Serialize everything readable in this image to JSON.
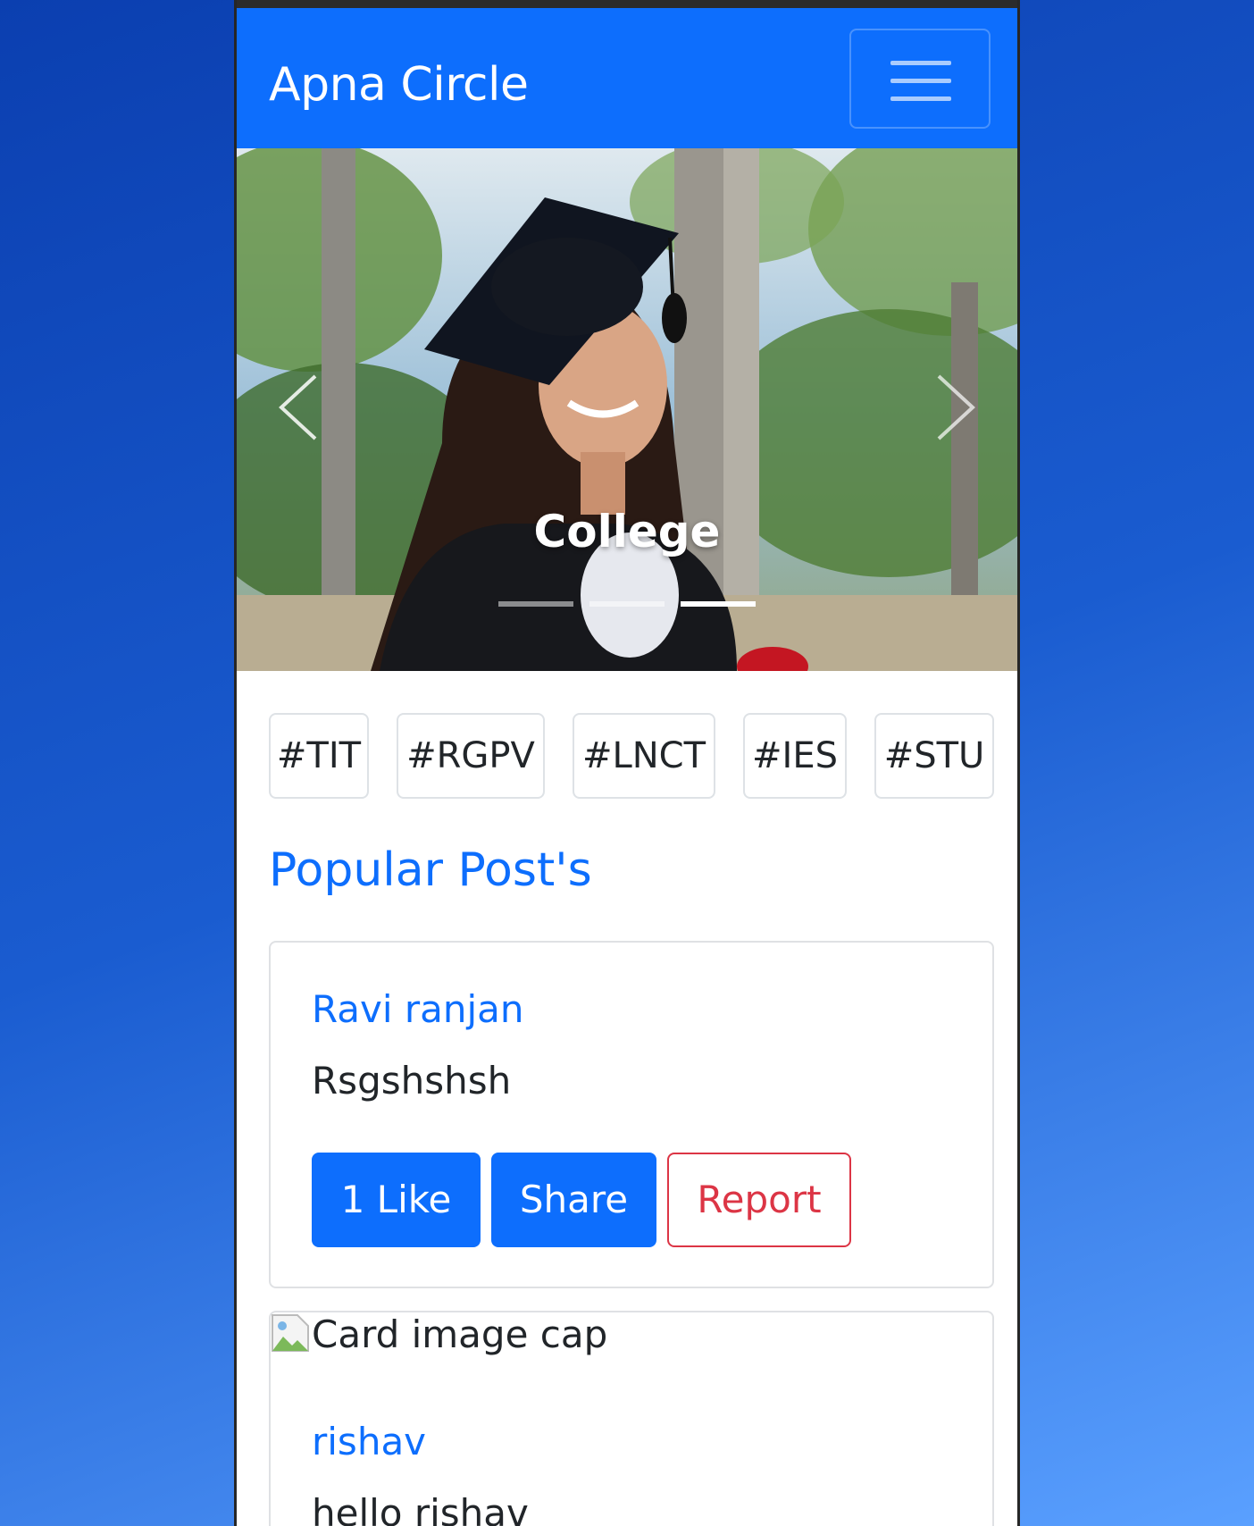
{
  "navbar": {
    "brand": "Apna Circle",
    "toggler_icon": "hamburger-menu-icon"
  },
  "carousel": {
    "caption": "College",
    "slide_count": 3,
    "active_slide": 3,
    "prev_icon": "chevron-left-icon",
    "next_icon": "chevron-right-icon"
  },
  "tags": [
    "#TIT",
    "#RGPV",
    "#LNCT",
    "#IES",
    "#STU"
  ],
  "section_title": "Popular Post's",
  "posts": [
    {
      "author": "Ravi ranjan",
      "text": "Rsgshshsh",
      "like_label": "1 Like",
      "share_label": "Share",
      "report_label": "Report"
    },
    {
      "image_alt": "Card image cap",
      "author": "rishav",
      "text": "hello rishav"
    }
  ],
  "colors": {
    "primary": "#0d6efd",
    "danger": "#dc3545",
    "text": "#212529"
  }
}
